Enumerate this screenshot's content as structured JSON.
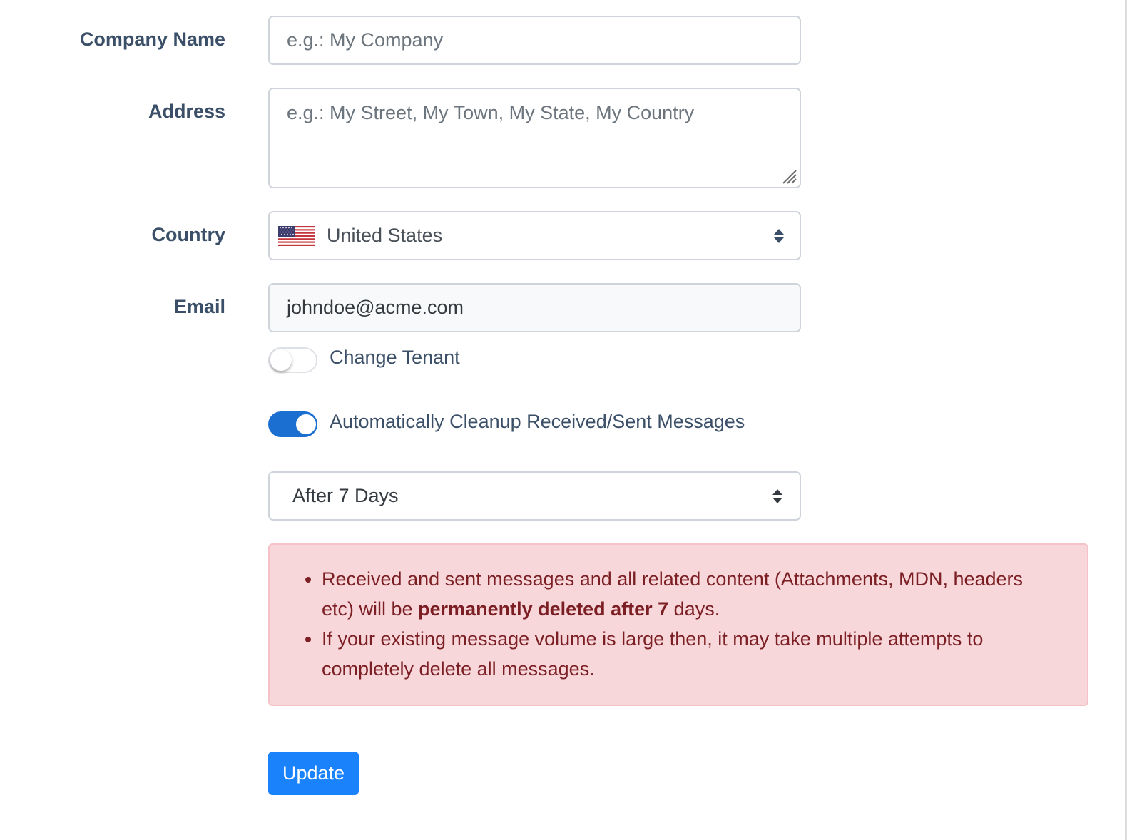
{
  "form": {
    "company_name": {
      "label": "Company Name",
      "value": "",
      "placeholder": "e.g.: My Company"
    },
    "address": {
      "label": "Address",
      "value": "",
      "placeholder": "e.g.: My Street, My Town, My State, My Country"
    },
    "country": {
      "label": "Country",
      "selected": "United States",
      "flag_icon": "us-flag-icon"
    },
    "email": {
      "label": "Email",
      "value": "johndoe@acme.com",
      "readonly": true
    },
    "change_tenant": {
      "label": "Change Tenant",
      "checked": false
    },
    "auto_cleanup": {
      "label": "Automatically Cleanup Received/Sent Messages",
      "checked": true
    },
    "cleanup_period": {
      "selected": "After 7 Days"
    },
    "warning": {
      "items": [
        {
          "before": "Received and sent messages and all related content (Attachments, MDN, headers etc) will be ",
          "bold": "permanently deleted after 7",
          "after": " days."
        },
        {
          "text": "If your existing message volume is large then, it may take multiple attempts to completely delete all messages."
        }
      ]
    },
    "update_button": "Update"
  },
  "colors": {
    "primary": "#1a82fb",
    "toggle_on": "#1a6fd0",
    "label": "#3b5068",
    "alert_bg": "#f8d7da",
    "alert_text": "#7b1f24"
  }
}
